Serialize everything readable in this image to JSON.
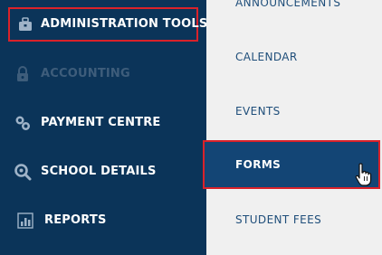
{
  "sidebar": {
    "items": [
      {
        "label": "ADMINISTRATION TOOLS",
        "icon": "briefcase-icon",
        "state": "highlighted"
      },
      {
        "label": "ACCOUNTING",
        "icon": "lock-icon",
        "state": "disabled"
      },
      {
        "label": "PAYMENT CENTRE",
        "icon": "coins-icon",
        "state": "normal"
      },
      {
        "label": "SCHOOL DETAILS",
        "icon": "search-icon",
        "state": "normal"
      },
      {
        "label": "REPORTS",
        "icon": "bar-chart-icon",
        "state": "normal"
      }
    ]
  },
  "submenu": {
    "items": [
      {
        "label": "ANNOUNCEMENTS"
      },
      {
        "label": "CALENDAR"
      },
      {
        "label": "EVENTS"
      },
      {
        "label": "FORMS",
        "state": "active"
      },
      {
        "label": "STUDENT FEES"
      }
    ]
  },
  "colors": {
    "sidebar_bg": "#0b3459",
    "submenu_bg": "#f0f0f0",
    "active_bg": "#134575",
    "highlight_border": "#d9222a",
    "link_text": "#1f4e7a",
    "disabled_text": "#3e5d7b"
  }
}
